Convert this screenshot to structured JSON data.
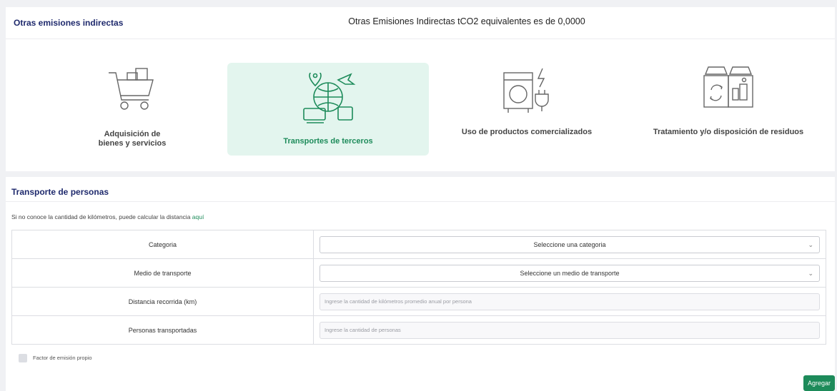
{
  "header": {
    "title": "Otras emisiones indirectas",
    "summary": "Otras Emisiones Indirectas tCO2 equivalentes es de 0,0000"
  },
  "categories": [
    {
      "label_line1": "Adquisición de",
      "label_line2": "bienes y servicios",
      "icon": "shopping-cart-icon",
      "active": false
    },
    {
      "label_line1": "Transportes de terceros",
      "label_line2": "",
      "icon": "transport-globe-icon",
      "active": true
    },
    {
      "label_line1": "Uso de productos comercializados",
      "label_line2": "",
      "icon": "washing-machine-plug-icon",
      "active": false
    },
    {
      "label_line1": "Tratamiento y/o disposición de residuos",
      "label_line2": "",
      "icon": "recycling-bins-icon",
      "active": false
    }
  ],
  "section": {
    "title": "Transporte de personas",
    "hint_text": "Si no conoce la cantidad de kilómetros, puede calcular la distancia ",
    "hint_link": "aquí"
  },
  "form": {
    "categoria_label": "Categoria",
    "categoria_value": "Seleccione una categoria",
    "medio_label": "Medio de transporte",
    "medio_value": "Seleccione un medio de transporte",
    "distancia_label": "Distancia recorrida (km)",
    "distancia_placeholder": "Ingrese la cantidad de kilómetros promedio anual por persona",
    "personas_label": "Personas transportadas",
    "personas_placeholder": "Ingrese la cantidad de personas"
  },
  "checkbox_label": "Factor de emisión propio",
  "submit_label": "Agregar",
  "colors": {
    "accent": "#1d8b5a",
    "title": "#1f2a6d",
    "active_bg": "#e3f5ee"
  }
}
